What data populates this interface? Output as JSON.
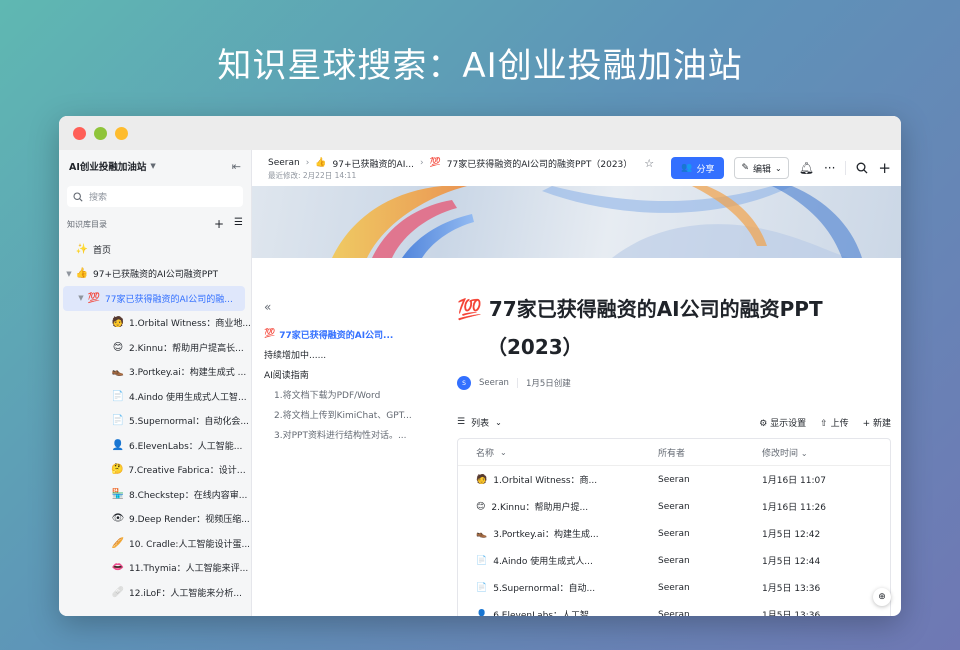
{
  "headline": "知识星球搜索：AI创业投融加油站",
  "sidebar": {
    "title": "AI创业投融加油站",
    "search_placeholder": "搜索",
    "section_label": "知识库目录",
    "items": [
      {
        "label": "首页",
        "icon": "✨",
        "indent": 0,
        "caret": ""
      },
      {
        "label": "97+已获融资的AI公司融资PPT",
        "icon": "👍",
        "indent": 0,
        "caret": "▼"
      },
      {
        "label": "77家已获得融资的AI公司的融...",
        "icon": "💯",
        "indent": 1,
        "caret": "▼"
      },
      {
        "label": "1.Orbital Witness：商业地...",
        "icon": "🧑",
        "indent": 2,
        "caret": ""
      },
      {
        "label": "2.Kinnu：帮助用户提高长...",
        "icon": "😊",
        "indent": 2,
        "caret": ""
      },
      {
        "label": "3.Portkey.ai：构建生成式 ...",
        "icon": "👞",
        "indent": 2,
        "caret": ""
      },
      {
        "label": "4.Aindo 使用生成式人工智...",
        "icon": "📄",
        "indent": 2,
        "caret": ""
      },
      {
        "label": "5.Supernormal：自动化会...",
        "icon": "📄",
        "indent": 2,
        "caret": ""
      },
      {
        "label": "6.ElevenLabs：人工智能...",
        "icon": "👤",
        "indent": 2,
        "caret": ""
      },
      {
        "label": "7.Creative Fabrica：设计初...",
        "icon": "🤔",
        "indent": 2,
        "caret": ""
      },
      {
        "label": "8.Checkstep：在线内容审...",
        "icon": "🏪",
        "indent": 2,
        "caret": ""
      },
      {
        "label": "9.Deep Render：视频压缩...",
        "icon": "👁",
        "indent": 2,
        "caret": ""
      },
      {
        "label": "10. Cradle:人工智能设计蛋...",
        "icon": "🥖",
        "indent": 2,
        "caret": ""
      },
      {
        "label": "11.Thymia：人工智能来评...",
        "icon": "👄",
        "indent": 2,
        "caret": ""
      },
      {
        "label": "12.iLoF：人工智能来分析...",
        "icon": "🩹",
        "indent": 2,
        "caret": ""
      }
    ]
  },
  "topbar": {
    "crumbs": [
      "Seeran",
      "97+已获融资的AI...",
      "77家已获得融资的AI公司的融资PPT（2023）"
    ],
    "crumb_icons": [
      "",
      "👍",
      "💯"
    ],
    "last_modified": "最近修改: 2月22日 14:11",
    "share_label": "分享",
    "edit_label": "编辑"
  },
  "outline": [
    {
      "label": "77家已获得融资的AI公司...",
      "level": 0,
      "icon": "💯"
    },
    {
      "label": "持续增加中......",
      "level": 0,
      "icon": ""
    },
    {
      "label": "AI阅读指南",
      "level": 0,
      "icon": ""
    },
    {
      "label": "1.将文档下载为PDF/Word",
      "level": 1,
      "icon": ""
    },
    {
      "label": "2.将文档上传到KimiChat、GPT...",
      "level": 1,
      "icon": ""
    },
    {
      "label": "3.对PPT资料进行结构性对话。...",
      "level": 1,
      "icon": ""
    }
  ],
  "doc": {
    "title_icon": "💯",
    "title_line1": "77家已获得融资的AI公司的融资PPT",
    "title_line2": "（2023）",
    "author": "Seeran",
    "avatar_text": "S",
    "created": "1月5日创建",
    "view_label": "列表",
    "actions": [
      "显示设置",
      "上传",
      "新建"
    ],
    "columns": [
      "名称",
      "所有者",
      "修改时间"
    ],
    "rows": [
      {
        "icon": "🧑",
        "name": "1.Orbital Witness：商...",
        "owner": "Seeran",
        "time": "1月16日 11:07"
      },
      {
        "icon": "😊",
        "name": "2.Kinnu：帮助用户提...",
        "owner": "Seeran",
        "time": "1月16日 11:26"
      },
      {
        "icon": "👞",
        "name": "3.Portkey.ai：构建生成...",
        "owner": "Seeran",
        "time": "1月5日 12:42"
      },
      {
        "icon": "📄",
        "name": "4.Aindo 使用生成式人...",
        "owner": "Seeran",
        "time": "1月5日 12:44"
      },
      {
        "icon": "📄",
        "name": "5.Supernormal：自动...",
        "owner": "Seeran",
        "time": "1月5日 13:36"
      },
      {
        "icon": "👤",
        "name": "6.ElevenLabs：人工智...",
        "owner": "Seeran",
        "time": "1月5日 13:36"
      }
    ]
  },
  "colors": {
    "accent": "#3370ff",
    "active_bg": "#dfe7fb"
  }
}
